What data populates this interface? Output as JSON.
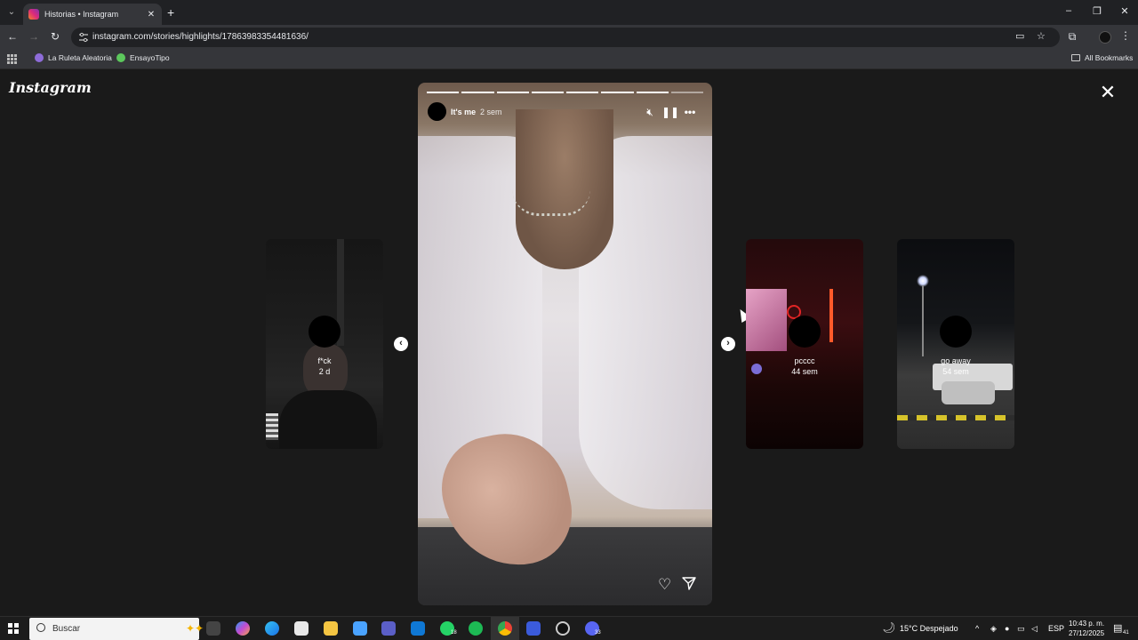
{
  "browser": {
    "tab_title": "Historias • Instagram",
    "url": "instagram.com/stories/highlights/17863983354481636/",
    "bookmarks": [
      {
        "label": "La Ruleta Aleatoria",
        "color": "#8e6cd9"
      },
      {
        "label": "EnsayoTipo",
        "color": "#5cc85c"
      }
    ],
    "all_bookmarks_label": "All Bookmarks"
  },
  "instagram": {
    "logo": "Instagram",
    "story": {
      "username": "It's me",
      "time": "2 sem",
      "progress_segments": 8,
      "completed_segments": 7
    },
    "previews": [
      {
        "name": "f*ck",
        "time": "2 d"
      },
      {
        "name": "pcccc",
        "time": "44 sem"
      },
      {
        "name": "go away",
        "time": "54 sem"
      }
    ]
  },
  "taskbar": {
    "search_placeholder": "Buscar",
    "whatsapp_badge": "18",
    "discord_badge": "33",
    "weather": "15°C  Despejado",
    "language": "ESP",
    "time": "10:43 p. m.",
    "date": "27/12/2025",
    "notification_count": "41"
  },
  "icons": [
    "tab-list-icon",
    "instagram-favicon",
    "new-tab-icon",
    "minimize-icon",
    "restore-icon",
    "close-window-icon",
    "back-icon",
    "forward-icon",
    "reload-icon",
    "site-info-icon",
    "cast-icon",
    "bookmark-star-icon",
    "extensions-icon",
    "profile-avatar",
    "more-icon",
    "apps-icon",
    "folder-icon",
    "close-icon",
    "mute-icon",
    "pause-icon",
    "more-options-icon",
    "heart-icon",
    "send-icon",
    "chevron-left-icon",
    "chevron-right-icon",
    "windows-start-icon",
    "search-icon"
  ]
}
